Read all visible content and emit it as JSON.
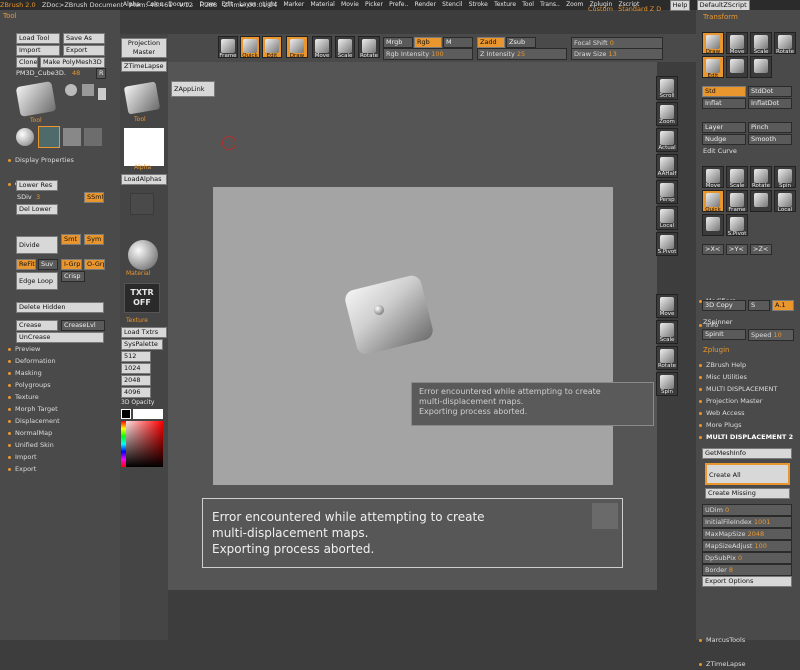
{
  "menubar": {
    "app": "ZBrush 2.0",
    "doc": "ZDoc>ZBrush Document",
    "mem": "Mem: 48.461",
    "vert": "V:12",
    "faces": "F:288",
    "ztime": "ZTime: 00:01:04",
    "items": [
      "Alpha",
      "Color",
      "Docum..",
      "Draw",
      "Edit",
      "Layer",
      "Light",
      "Marker",
      "Material",
      "Movie",
      "Picker",
      "Prefe..",
      "Render",
      "Stencil",
      "Stroke",
      "Texture",
      "Tool",
      "Trans..",
      "Zoom",
      "Zplugin",
      "Zscript"
    ],
    "custom": "Custom",
    "standard": "Standard Z D",
    "help": "Help",
    "default": "DefaultZScript"
  },
  "left": {
    "title": "Tool",
    "load_tool": "Load Tool",
    "save_as": "Save As",
    "import": "Import",
    "export": "Export",
    "clone": "Clone",
    "make_poly": "Make PolyMesh3D",
    "tool_name": "PM3D_Cube3D.",
    "tool_num": "48",
    "r": "R",
    "tool_label": "Tool",
    "display_props": "Display Properties",
    "geometry": "Geometry",
    "lower_res": "Lower Res",
    "sdiv": "SDiv",
    "sdiv_val": "3",
    "ssmt": "SSmt",
    "del_lower": "Del Lower",
    "divide": "Divide",
    "smt": "Smt",
    "sym": "Sym",
    "refit": "ReFit",
    "suv": "Suv",
    "igrp": "I-Grp",
    "ogrp": "O-Grp",
    "edge_loop": "Edge Loop",
    "crisp": "Crisp",
    "del_hidden": "Delete Hidden",
    "crease": "Crease",
    "creaselvl": "CreaseLvl",
    "uncrease": "UnCrease",
    "subitems": [
      "Preview",
      "Deformation",
      "Masking",
      "Polygroups",
      "Texture",
      "Morph Target",
      "Displacement",
      "NormalMap",
      "Unified Skin",
      "Import",
      "Export"
    ]
  },
  "shelf": {
    "projection": "Projection",
    "master": "Master",
    "ztimelapse": "ZTimeLapse",
    "tool": "Tool",
    "alpha": "Alpha",
    "load_alphas": "LoadAlphas",
    "material": "Material",
    "txtr": "TXTR",
    "off": "OFF",
    "texture": "Texture",
    "load_txtrs": "Load Txtrs",
    "syspalette": "SysPalette",
    "sizes": [
      "512",
      "1024",
      "2048",
      "4096"
    ],
    "opacity": "3D Opacity"
  },
  "top": {
    "frame": "Frame",
    "quick": "Quick",
    "edit": "Edit",
    "draw": "Draw",
    "move": "Move",
    "scale": "Scale",
    "rotate": "Rotate",
    "mrgb": "Mrgb",
    "rgb": "Rgb",
    "m": "M",
    "zadd": "Zadd",
    "zsub": "Zsub",
    "rgb_int": "Rgb Intensity",
    "rgb_int_val": "100",
    "z_int": "Z Intensity",
    "z_int_val": "25",
    "focal": "Focal Shift",
    "focal_val": "0",
    "draw_size": "Draw Size",
    "draw_size_val": "13"
  },
  "canvas": {
    "zapplink": "ZAppLink",
    "right_icons": [
      "Scroll",
      "Zoom",
      "Actual",
      "AAHalf",
      "Persp",
      "Local",
      "S.Pivot",
      "Move",
      "Scale",
      "Rotate",
      "Spin"
    ]
  },
  "dialog_small": {
    "line1": "Error encountered while attempting to create",
    "line2": "multi-displacement maps.",
    "line3": "Exporting process aborted."
  },
  "dialog_big": {
    "line1": "Error encountered while attempting to create",
    "line2": "multi-displacement maps.",
    "line3": "Exporting process aborted."
  },
  "right": {
    "title": "Transform",
    "draw": "Draw",
    "move": "Move",
    "scale": "Scale",
    "rotate": "Rotate",
    "edit": "Edit",
    "std": "Std",
    "stddot": "StdDot",
    "inflat": "Inflat",
    "inflatdot": "InflatDot",
    "layer": "Layer",
    "pinch": "Pinch",
    "nudge": "Nudge",
    "smooth": "Smooth",
    "edit_curve": "Edit Curve",
    "quick": "Quick",
    "frame": "Frame",
    "local": "Local",
    "spivot": "S.Pivot",
    "x": ">X<",
    "y": ">Y<",
    "z": ">Z<",
    "modifiers": "Modifiers",
    "info": "Info",
    "copy3d": "3D Copy",
    "s": "S",
    "a1": "A.1",
    "zspinner": "ZSpinner",
    "spinit": "SpinIt",
    "speed": "Speed",
    "speed_val": "10",
    "zplugin": "Zplugin",
    "plugins": [
      "ZBrush Help",
      "Misc Utilities",
      "MULTI DISPLACEMENT",
      "Projection Master",
      "Web Access",
      "More Plugs",
      "MULTI DISPLACEMENT 2"
    ],
    "getmesh": "GetMeshInfo",
    "create_all": "Create All",
    "create_missing": "Create Missing",
    "udim": "UDim",
    "udim_val": "0",
    "initfile": "InitialFileIndex",
    "initfile_val": "1001",
    "maxmap": "MaxMapSize",
    "maxmap_val": "2048",
    "mapadj": "MapSizeAdjust",
    "mapadj_val": "100",
    "dpsub": "DpSubPix",
    "dpsub_val": "0",
    "border": "Border",
    "border_val": "8",
    "export_options": "Export Options",
    "marcus": "MarcusTools",
    "ztimelapse": "ZTimeLapse"
  }
}
